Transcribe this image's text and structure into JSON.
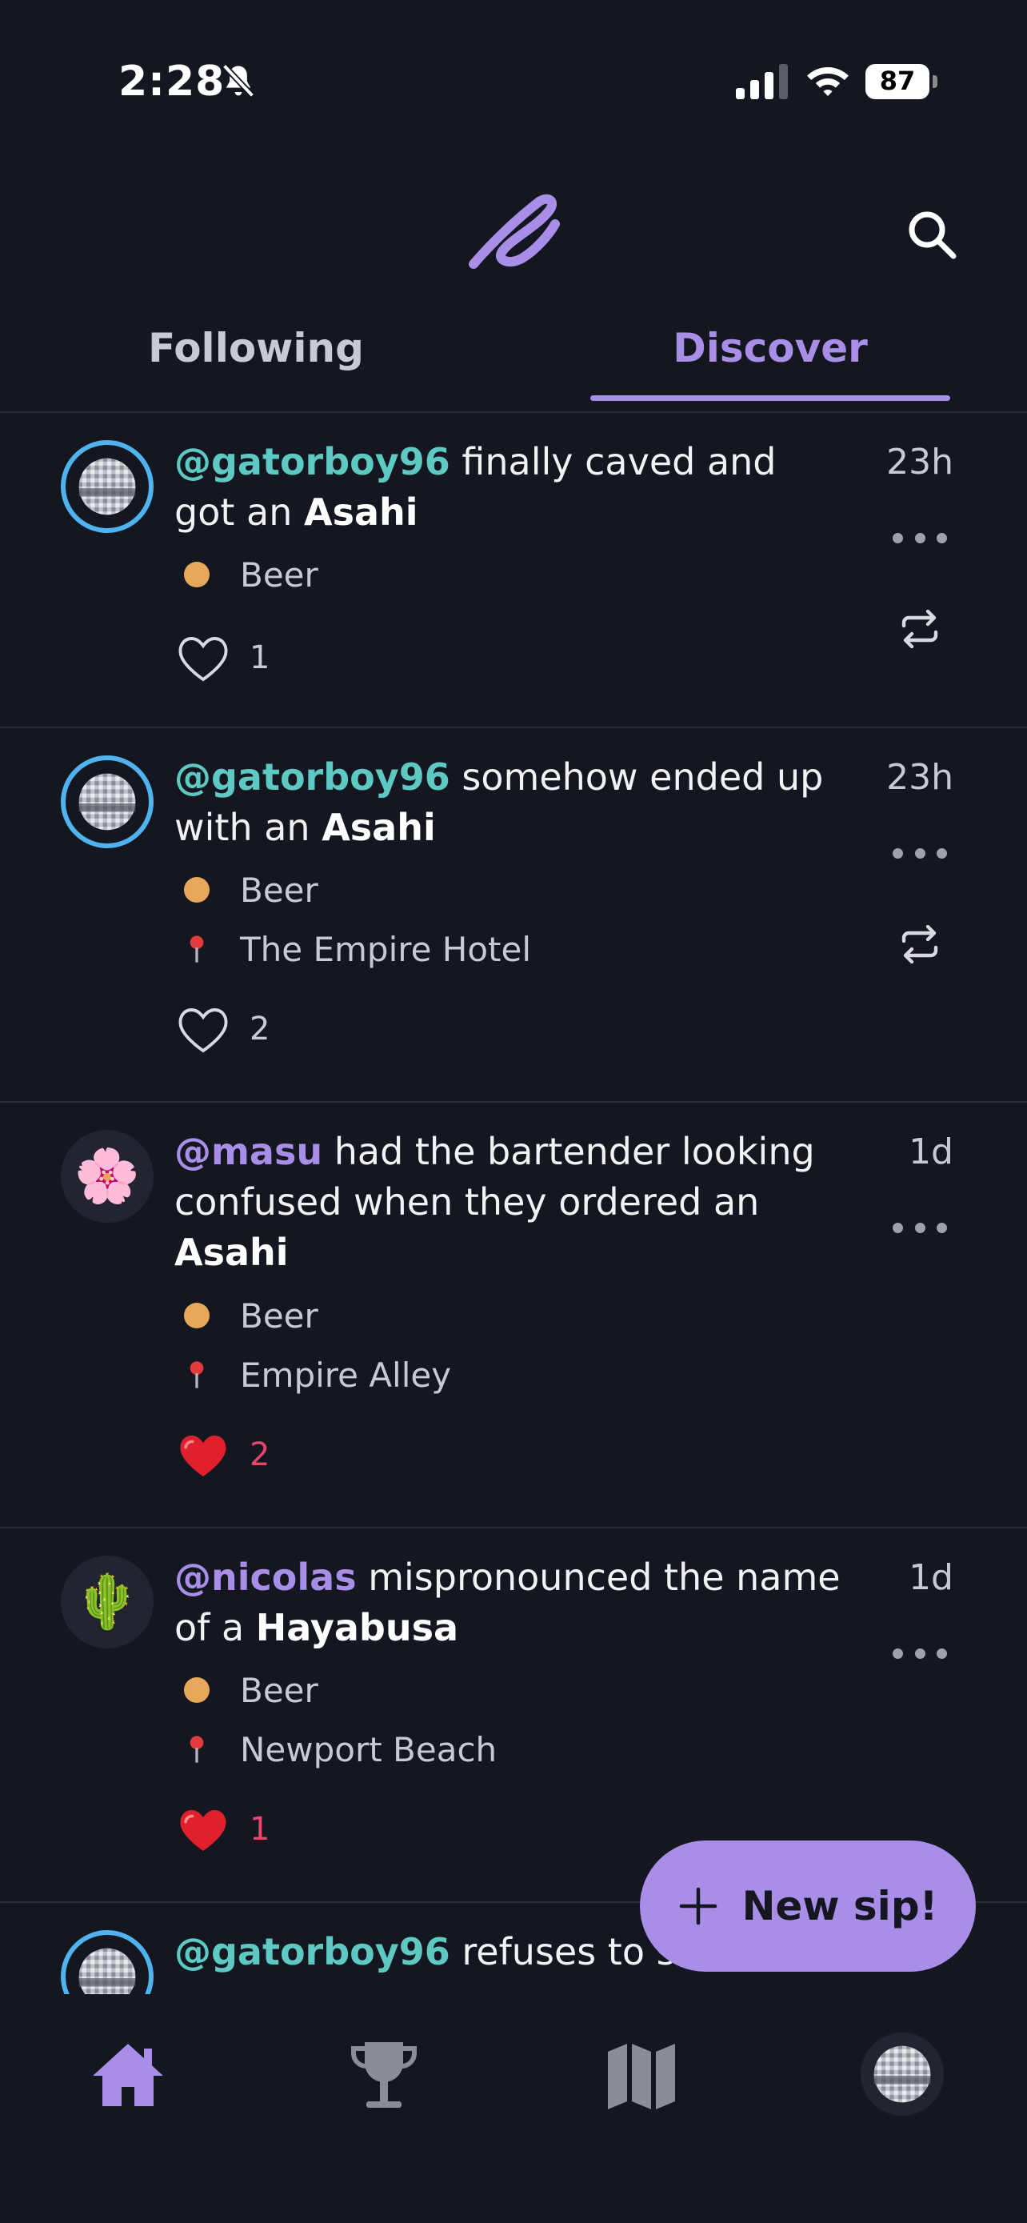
{
  "status_bar": {
    "time": "2:28",
    "battery": "87"
  },
  "header": {
    "logo_icon": "sip-logo-icon",
    "search_icon": "search-icon"
  },
  "tabs": [
    {
      "label": "Following",
      "active": false
    },
    {
      "label": "Discover",
      "active": true
    }
  ],
  "posts": [
    {
      "handle": "@gatorboy96",
      "action": " finally caved and got an ",
      "drink": "Asahi",
      "category": "Beer",
      "location": "",
      "likes": "1",
      "liked": false,
      "time": "23h",
      "avatar": "disco-ball"
    },
    {
      "handle": "@gatorboy96",
      "action": " somehow ended up with an ",
      "drink": "Asahi",
      "category": "Beer",
      "location": "The Empire Hotel",
      "likes": "2",
      "liked": false,
      "time": "23h",
      "avatar": "disco-ball"
    },
    {
      "handle": "@masu",
      "action": " had the bartender looking confused when they ordered an ",
      "drink": "Asahi",
      "category": "Beer",
      "location": "Empire Alley",
      "likes": "2",
      "liked": true,
      "time": "1d",
      "avatar": "🌸"
    },
    {
      "handle": "@nicolas",
      "action": " mispronounced the name of a ",
      "drink": "Hayabusa",
      "category": "Beer",
      "location": "Newport Beach",
      "likes": "1",
      "liked": true,
      "time": "1d",
      "avatar": "🌵"
    },
    {
      "handle": "@gatorboy96",
      "action": " refuses to sh",
      "avatar": "disco-ball"
    }
  ],
  "fab": {
    "label": "New sip!"
  },
  "colors": {
    "background": "#141620",
    "accent": "#a98ee8",
    "teal_handle": "#5ec9c2",
    "ring": "#4fb3f0",
    "beer_dot": "#e8a85a",
    "like_red": "#e8466c"
  },
  "bottom_nav": [
    "home-icon",
    "trophy-icon",
    "map-icon",
    "profile-avatar"
  ]
}
